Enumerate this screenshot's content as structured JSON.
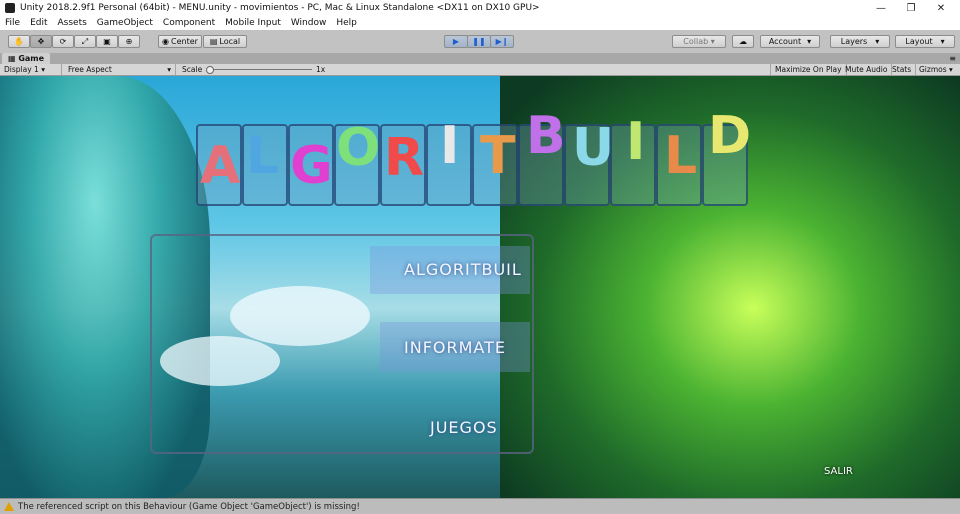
{
  "window": {
    "title": "Unity 2018.2.9f1 Personal (64bit) - MENU.unity - movimientos - PC, Mac & Linux Standalone <DX11 on DX10 GPU>",
    "minimize": "—",
    "maximize": "❐",
    "close": "✕"
  },
  "menu": [
    "File",
    "Edit",
    "Assets",
    "GameObject",
    "Component",
    "Mobile Input",
    "Window",
    "Help"
  ],
  "toolbar": {
    "tools": [
      "hand-icon",
      "move-icon",
      "rotate-icon",
      "scale-icon",
      "rect-icon",
      "transform-icon"
    ],
    "pivot_label": "Center",
    "space_label": "Local",
    "collab_label": "Collab ▾",
    "account_label": "Account",
    "layers_label": "Layers",
    "layout_label": "Layout"
  },
  "game_tab": {
    "label": "Game"
  },
  "game_toolbar": {
    "display": "Display 1",
    "aspect": "Free Aspect",
    "scale_label": "Scale",
    "scale_value": "1x",
    "scale_level": 0.02,
    "maximize_on_play": "Maximize On Play",
    "mute_audio": "Mute Audio",
    "stats": "Stats",
    "gizmos": "Gizmos"
  },
  "game_view": {
    "logo_letters": [
      "A",
      "L",
      "G",
      "O",
      "R",
      "I",
      "T",
      "B",
      "U",
      "I",
      "L",
      "D"
    ],
    "logo_colors": [
      "#e5707a",
      "#4fa6e0",
      "#e03fd0",
      "#7de07a",
      "#f04a4a",
      "#e8e8e8",
      "#e89a4a",
      "#c070e8",
      "#8ad8e8",
      "#c0e870",
      "#e88a4a",
      "#e8e870"
    ],
    "buttons": [
      {
        "label": "ALGORITBUIL"
      },
      {
        "label": "INFORMATE"
      },
      {
        "label": "JUEGOS"
      }
    ],
    "exit_label": "SALIR"
  },
  "status": {
    "message": "The referenced script on this Behaviour (Game Object 'GameObject') is missing!"
  }
}
